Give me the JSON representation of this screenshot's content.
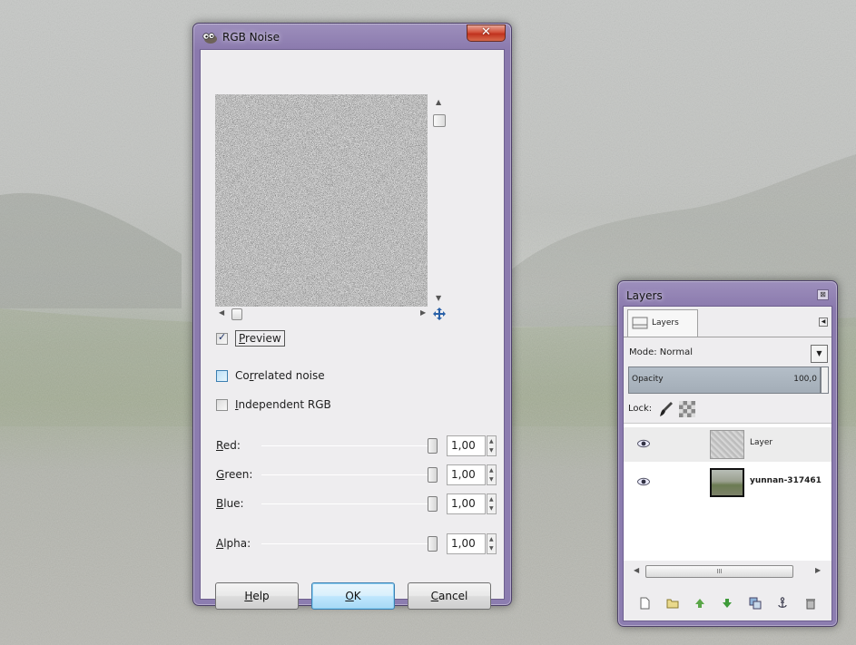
{
  "dialog": {
    "title": "RGB Noise",
    "close_glyph": "✕",
    "preview_label": "Preview",
    "preview_checked": true,
    "correlated_label": "Correlated noise",
    "correlated_checked": false,
    "independent_label": "Independent RGB",
    "independent_checked": false,
    "sliders": [
      {
        "label": "Red:",
        "value": "1,00"
      },
      {
        "label": "Green:",
        "value": "1,00"
      },
      {
        "label": "Blue:",
        "value": "1,00"
      },
      {
        "label": "Alpha:",
        "value": "1,00"
      }
    ],
    "buttons": {
      "help": "Help",
      "ok": "OK",
      "cancel": "Cancel"
    }
  },
  "layers_dock": {
    "title": "Layers",
    "tab_label": "Layers",
    "mode_label": "Mode: Normal",
    "opacity_label": "Opacity",
    "opacity_value": "100,0",
    "lock_label": "Lock:",
    "layers": [
      {
        "name": "Layer",
        "selected": true
      },
      {
        "name": "yunnan-317461",
        "selected": false
      }
    ],
    "scroll_grip": "III"
  },
  "colors": {
    "window_frame": "#8a79ad",
    "client_bg": "#eeedef",
    "close_red": "#c0321e",
    "default_button": "#bee6fd",
    "opacity_bar": "#a3adb7"
  },
  "icons": [
    "gimp-wilber-icon",
    "close-icon",
    "navigate-icon",
    "eye-icon",
    "brush-lock-icon",
    "alpha-lock-icon",
    "new-layer-icon",
    "new-group-icon",
    "raise-layer-icon",
    "lower-layer-icon",
    "duplicate-layer-icon",
    "anchor-layer-icon",
    "delete-layer-icon"
  ]
}
